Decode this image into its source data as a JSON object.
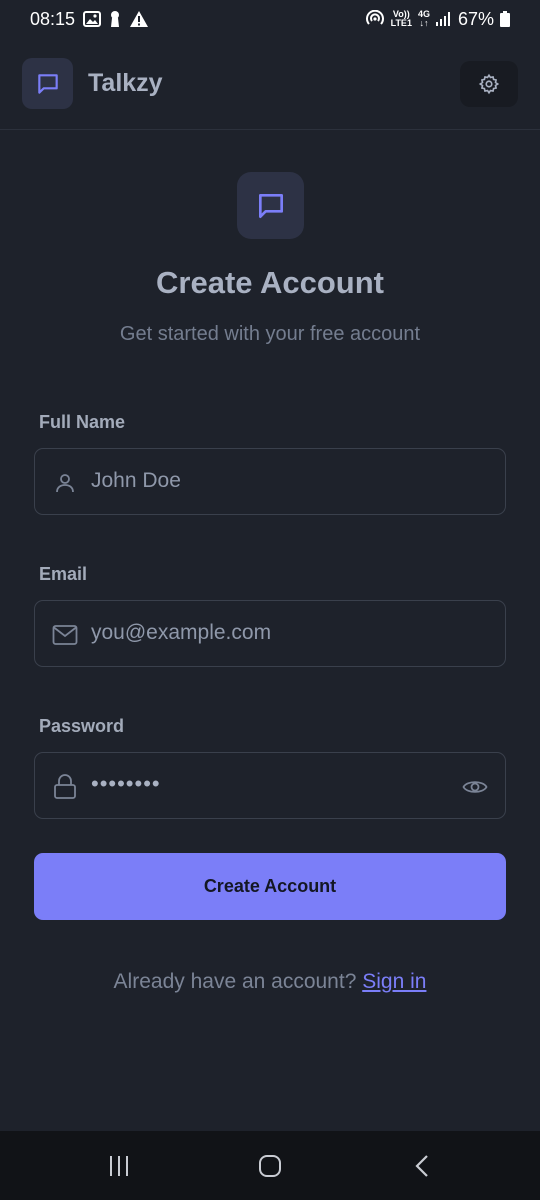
{
  "status_bar": {
    "time": "08:15",
    "network_top": "Vo))",
    "network_bottom": "LTE1",
    "gen_top": "4G",
    "gen_bottom": "↓↑",
    "battery": "67%"
  },
  "header": {
    "app_name": "Talkzy",
    "logo_icon": "chat-bubble-icon",
    "settings_icon": "gear-icon"
  },
  "hero": {
    "icon": "chat-bubble-icon",
    "title": "Create Account",
    "subtitle": "Get started with your free account"
  },
  "form": {
    "full_name": {
      "label": "Full Name",
      "placeholder": "John Doe",
      "icon": "user-icon"
    },
    "email": {
      "label": "Email",
      "placeholder": "you@example.com",
      "icon": "mail-icon"
    },
    "password": {
      "label": "Password",
      "value": "••••••••",
      "icon": "lock-icon",
      "toggle_icon": "eye-icon"
    },
    "submit_label": "Create Account"
  },
  "footer": {
    "prompt": "Already have an account? ",
    "link": "Sign in"
  },
  "colors": {
    "background": "#1e222b",
    "accent": "#7b7ef8",
    "icon_box": "#2d3245"
  }
}
